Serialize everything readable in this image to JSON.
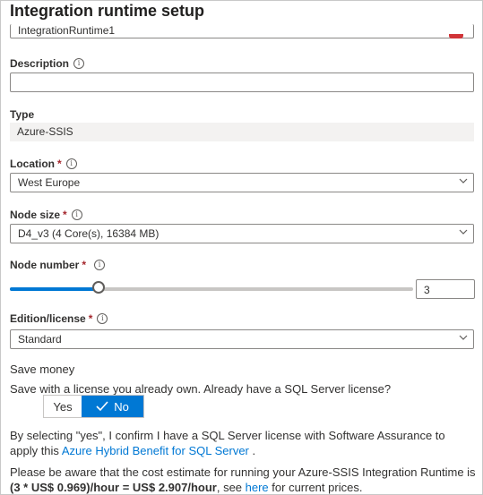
{
  "title": "Integration runtime setup",
  "name_field": {
    "value": "IntegrationRuntime1"
  },
  "description": {
    "label": "Description",
    "value": ""
  },
  "type": {
    "label": "Type",
    "value": "Azure-SSIS"
  },
  "location": {
    "label": "Location",
    "required": "*",
    "value": "West Europe"
  },
  "node_size": {
    "label": "Node size",
    "required": "*",
    "value": "D4_v3 (4 Core(s), 16384 MB)"
  },
  "node_number": {
    "label": "Node number",
    "required": "*",
    "value": "3",
    "slider_fraction": 0.22
  },
  "edition": {
    "label": "Edition/license",
    "required": "*",
    "value": "Standard"
  },
  "save_money": {
    "heading": "Save money",
    "question": "Save with a license you already own. Already have a SQL Server license?",
    "yes_label": "Yes",
    "no_label": "No",
    "selected": "No"
  },
  "hybrid": {
    "text_before": "By selecting \"yes\", I confirm I have a SQL Server license with Software Assurance to apply this ",
    "link": "Azure Hybrid Benefit for SQL Server",
    "text_after": " ."
  },
  "cost": {
    "text": "Please be aware that the cost estimate for running your Azure-SSIS Integration Runtime is ",
    "bold": "(3 * US$ 0.969)/hour = US$ 2.907/hour",
    "after": ", see ",
    "link": "here",
    "end": " for current prices."
  },
  "colors": {
    "accent": "#0078d4",
    "required": "#a4262c",
    "error": "#d13438"
  }
}
